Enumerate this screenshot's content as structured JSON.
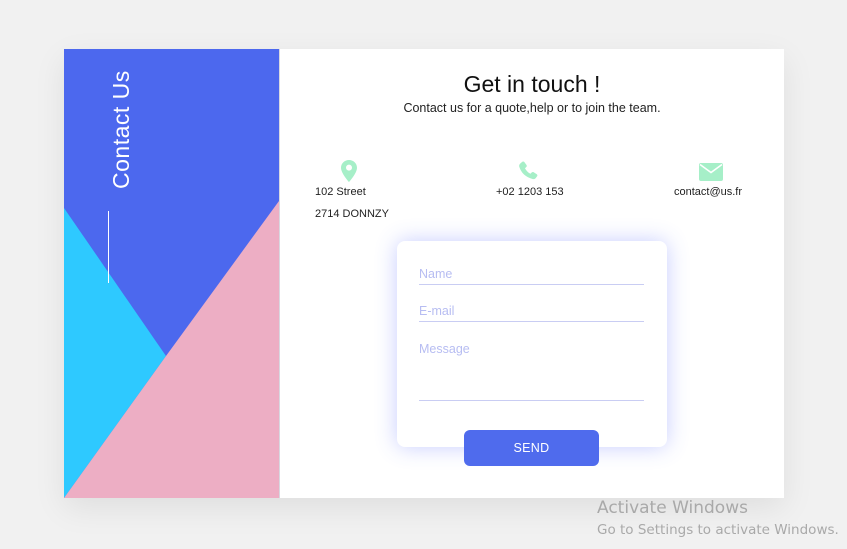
{
  "sidebar": {
    "title": "Contact Us"
  },
  "header": {
    "title": "Get in touch !",
    "subtitle": "Contact us for a quote,help or to join the team."
  },
  "contact": {
    "address_line1": "102 Street",
    "address_line2": "2714 DONNZY",
    "phone": "+02 1203 153",
    "email": "contact@us.fr",
    "icons": [
      "map-pin-icon",
      "phone-icon",
      "envelope-icon"
    ]
  },
  "form": {
    "name_placeholder": "Name",
    "email_placeholder": "E-mail",
    "message_placeholder": "Message",
    "send_label": "SEND"
  },
  "watermark": {
    "line1": "Activate Windows",
    "line2": "Go to Settings to activate Windows."
  },
  "colors": {
    "blue": "#4c68ee",
    "cyan": "#2ec9ff",
    "pink": "#edaec4",
    "icon_green": "#a6efc8",
    "button": "#4f6bed"
  }
}
